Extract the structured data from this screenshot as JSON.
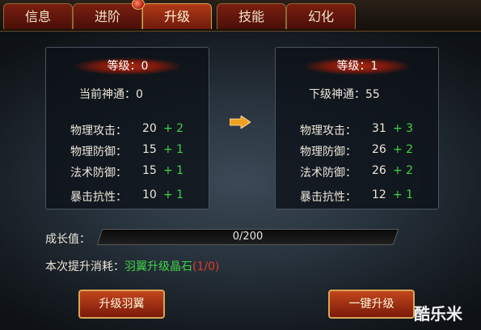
{
  "tabs": [
    "信息",
    "进阶",
    "升级",
    "技能",
    "幻化"
  ],
  "current": {
    "level": "等级：0",
    "power": "当前神通：0",
    "stats": [
      {
        "name": "物理攻击：",
        "value": "20",
        "bonus": "+ 2"
      },
      {
        "name": "物理防御：",
        "value": "15",
        "bonus": "+ 1"
      },
      {
        "name": "法术防御：",
        "value": "15",
        "bonus": "+ 1"
      },
      {
        "name": "暴击抗性：",
        "value": "10",
        "bonus": "+ 1"
      }
    ]
  },
  "next": {
    "level": "等级：1",
    "power": "下级神通：55",
    "stats": [
      {
        "name": "物理攻击：",
        "value": "31",
        "bonus": "+ 3"
      },
      {
        "name": "物理防御：",
        "value": "26",
        "bonus": "+ 2"
      },
      {
        "name": "法术防御：",
        "value": "26",
        "bonus": "+ 2"
      },
      {
        "name": "暴击抗性：",
        "value": "12",
        "bonus": "+ 1"
      }
    ]
  },
  "growth": {
    "label": "成长值：",
    "value": "0/200",
    "progress": 0
  },
  "cost": {
    "label": "本次提升消耗：",
    "item": "羽翼升级晶石",
    "count": "(1/0)"
  },
  "buttons": {
    "upgrade": "升级羽翼",
    "one_click": "一键升级"
  },
  "watermark": "酷乐米",
  "colors": {
    "bonus": "#3fd34a",
    "cost_item": "#3fd34a",
    "cost_count": "#e23a2a"
  }
}
